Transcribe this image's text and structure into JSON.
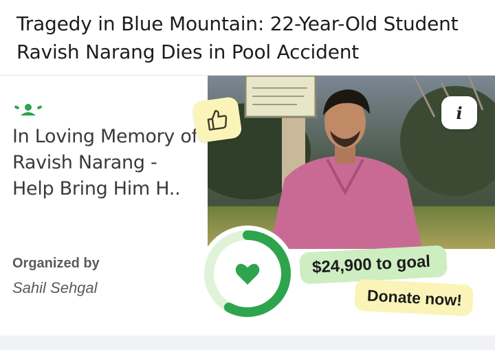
{
  "article": {
    "headline": "Tragedy in Blue Mountain: 22-Year-Old Student Ravish Narang Dies in Pool Accident"
  },
  "ad": {
    "brand_icon": "fundraiser-logo-icon",
    "title": "In Loving Memory of Ravish Narang - Help Bring Him H..",
    "organizer_label": "Organized by",
    "organizer_name": "Sahil Sehgal",
    "photo_alt": "Photo of Ravish Narang",
    "thumbs_icon": "thumbs-up-icon",
    "info_icon": "info-icon",
    "info_symbol": "i",
    "goal_text": "$24,900 to goal",
    "donate_label": "Donate now!",
    "progress_icon": "heart-icon",
    "progress_fraction": 0.58,
    "colors": {
      "brand_green": "#2ea44f",
      "goal_pill": "#cdeec1",
      "donate_pill": "#fbf4b9",
      "ring_track": "#dff3d9"
    }
  }
}
